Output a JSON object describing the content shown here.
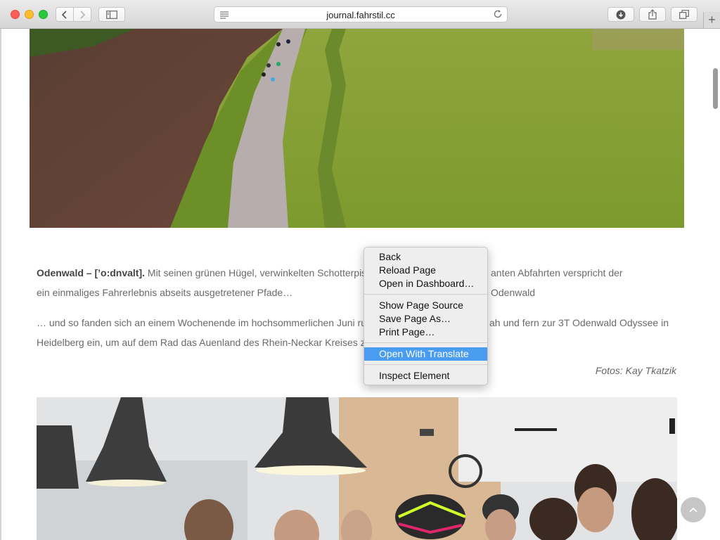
{
  "browser": {
    "url": "journal.fahrstil.cc",
    "new_tab_label": "+"
  },
  "article": {
    "p1_lead": "Odenwald – [’o:dnvalt].",
    "p1_text": " Mit seinen grünen Hügel, verwinkelten Schotterpiste",
    "p1_tail": "anten Abfahrten verspricht der Odenwald",
    "p1_line2": "ein einmaliges Fahrerlebnis abseits ausgetretener Pfade…",
    "p2_line1a": "… und so fanden sich an einem Wochenende im hochsommerlichen Juni ru",
    "p2_line1b": "ah und fern zur 3T Odenwald Odyssee in",
    "p2_line2": "Heidelberg ein, um auf dem Rad das Auenland des Rhein-Neckar Kreises zu",
    "credit": "Fotos: Kay Tkatzik"
  },
  "context_menu": {
    "items": [
      {
        "label": "Back"
      },
      {
        "label": "Reload Page"
      },
      {
        "label": "Open in Dashboard…"
      },
      {
        "label": "Show Page Source"
      },
      {
        "label": "Save Page As…"
      },
      {
        "label": "Print Page…"
      },
      {
        "label": "Open With Translate"
      },
      {
        "label": "Inspect Element"
      }
    ],
    "selected_index": 6
  },
  "colors": {
    "menu_highlight": "#4a9cf1",
    "body_text": "#6a6a6a"
  }
}
